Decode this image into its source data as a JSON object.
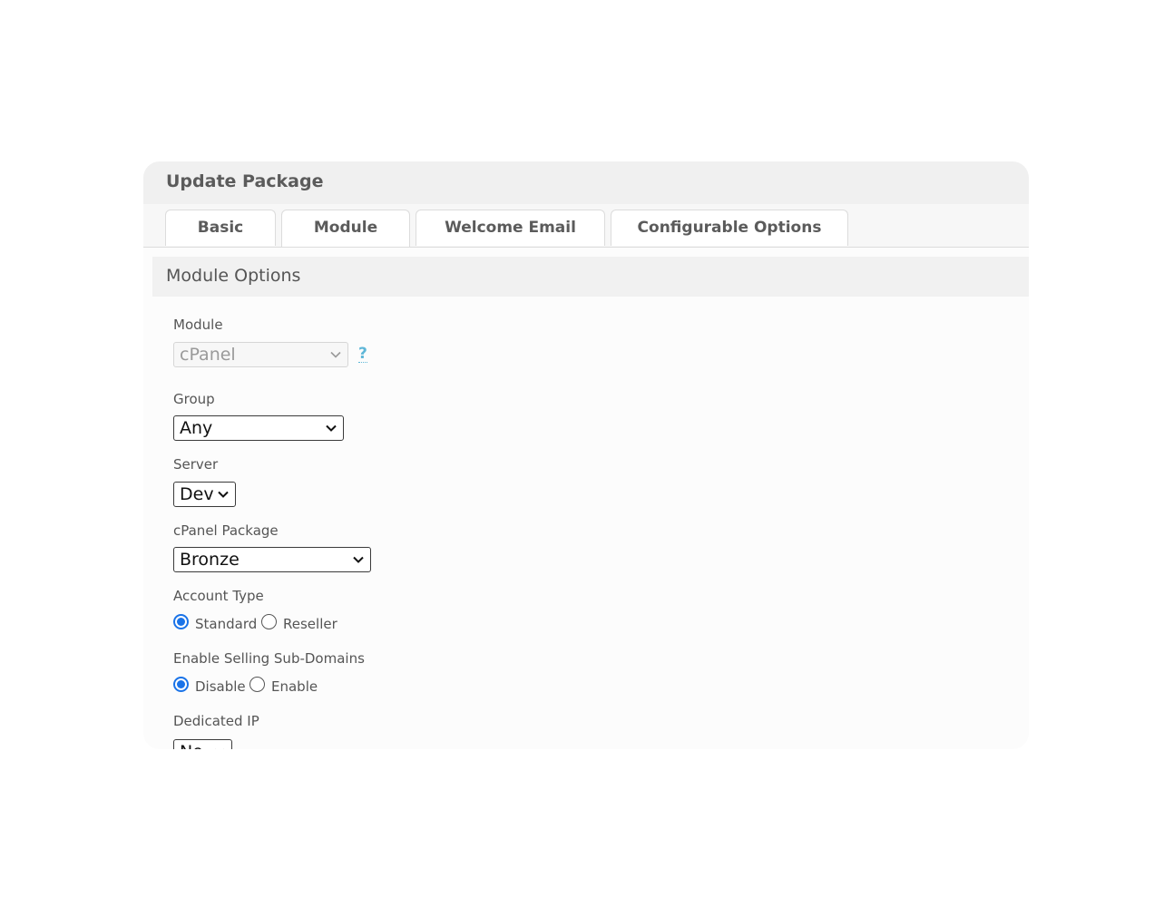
{
  "panel": {
    "title": "Update Package"
  },
  "tabs": [
    {
      "label": "Basic"
    },
    {
      "label": "Module",
      "active": true
    },
    {
      "label": "Welcome Email"
    },
    {
      "label": "Configurable Options"
    }
  ],
  "section": {
    "title": "Module Options"
  },
  "fields": {
    "module": {
      "label": "Module",
      "value": "cPanel",
      "help": "?"
    },
    "group": {
      "label": "Group",
      "value": "Any"
    },
    "server": {
      "label": "Server",
      "value": "Dev"
    },
    "package": {
      "label": "cPanel Package",
      "value": "Bronze"
    },
    "account_type": {
      "label": "Account Type",
      "options": [
        {
          "label": "Standard",
          "checked": true
        },
        {
          "label": "Reseller",
          "checked": false
        }
      ]
    },
    "subdomains": {
      "label": "Enable Selling Sub-Domains",
      "options": [
        {
          "label": "Disable",
          "checked": true
        },
        {
          "label": "Enable",
          "checked": false
        }
      ]
    },
    "dedicated_ip": {
      "label": "Dedicated IP",
      "value": "No"
    }
  },
  "colors": {
    "accent": "#1a73e8",
    "help": "#5fb7d8",
    "header_bg": "#f0f0f0",
    "text": "#555555"
  }
}
